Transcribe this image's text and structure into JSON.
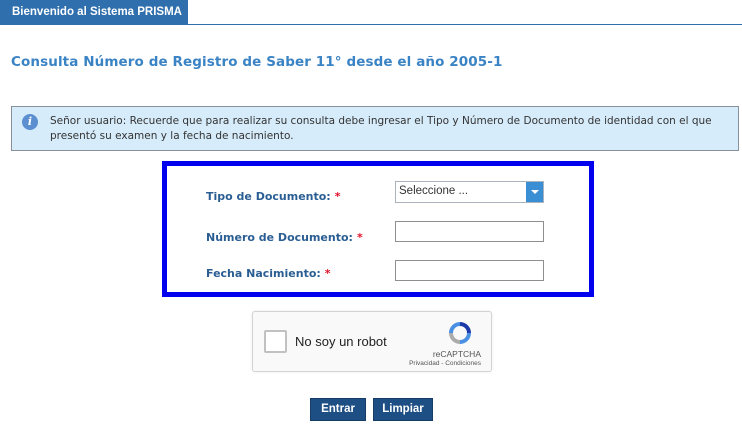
{
  "header": {
    "tab_label": "Bienvenido al Sistema PRISMA"
  },
  "page": {
    "title": "Consulta Número de Registro de Saber 11° desde el año 2005-1"
  },
  "notice": {
    "icon": "info-icon",
    "text": "Señor usuario: Recuerde que para realizar su consulta debe ingresar el Tipo y Número de Documento de identidad con el que presentó su examen y la fecha de nacimiento."
  },
  "form": {
    "document_type_label": "Tipo de Documento:",
    "document_type_value": "Seleccione ...",
    "document_number_label": "Número de Documento:",
    "document_number_value": "",
    "birth_date_label": "Fecha Nacimiento:",
    "birth_date_value": "",
    "required_mark": "*",
    "highlight_color": "#0000ee"
  },
  "captcha": {
    "label": "No soy un robot",
    "brand": "reCAPTCHA",
    "links": "Privacidad - Condiciones"
  },
  "actions": {
    "submit_label": "Entrar",
    "clear_label": "Limpiar"
  },
  "colors": {
    "brand_blue": "#2f6fad",
    "title_blue": "#3a83c4",
    "button_navy": "#1d4e84",
    "notice_bg": "#d7ecfa",
    "required_red": "#e0112b"
  }
}
